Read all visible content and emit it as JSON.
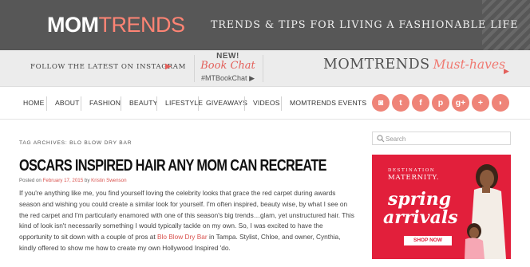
{
  "header": {
    "logo_part1": "MOM",
    "logo_part2": "TRENDS",
    "tagline": "TRENDS & TIPS FOR LIVING A FASHIONABLE LIFE"
  },
  "promo": {
    "instagram_label": "FOLLOW THE LATEST ON INSTAGRAM",
    "instagram_arrow": "▶",
    "book_new": "NEW!",
    "book_title": "Book Chat",
    "book_hashtag": "#MTBookChat",
    "book_arrow": "▶",
    "musthaves_main": "MOMTRENDS",
    "musthaves_sub": "Must-haves",
    "musthaves_arrow": "▶"
  },
  "nav": {
    "items": [
      "HOME",
      "ABOUT",
      "FASHION",
      "BEAUTY",
      "LIFESTYLE",
      "GIVEAWAYS",
      "VIDEOS",
      "MOMTRENDS EVENTS"
    ]
  },
  "social": [
    {
      "icon": "instagram-icon",
      "glyph": "◙"
    },
    {
      "icon": "twitter-icon",
      "glyph": "t"
    },
    {
      "icon": "facebook-icon",
      "glyph": "f"
    },
    {
      "icon": "pinterest-icon",
      "glyph": "p"
    },
    {
      "icon": "google-plus-icon",
      "glyph": "g+"
    },
    {
      "icon": "add-icon",
      "glyph": "+"
    },
    {
      "icon": "rss-icon",
      "glyph": "◗"
    }
  ],
  "colors": {
    "header_bg": "#575757",
    "accent": "#ef8478",
    "link": "#d9534f",
    "ad_bg": "#e21f3b"
  },
  "content": {
    "tag_archive": "TAG ARCHIVES: BLO BLOW DRY BAR",
    "title": "OSCARS INSPIRED HAIR ANY MOM CAN RECREATE",
    "meta_prefix": "Posted on ",
    "meta_date": "February 17, 2015",
    "meta_by": " by ",
    "meta_author": "Kristin Swenson",
    "body_part1": "If you're anything like me, you find yourself loving the celebrity looks that grace the red carpet during awards season and wishing you could create a similar look for yourself. I'm often inspired, beauty wise, by what I see on the red carpet and I'm particularly enamored with one of this season's big trends…glam, yet unstructured hair. This kind of look isn't necessarily something I would typically tackle on my own. So, I was excited to have the opportunity to sit down with a couple of pros at ",
    "body_link": "Blo Blow Dry Bar",
    "body_part2": " in Tampa. Stylist, Chloe, and owner, Cynthia, kindly offered to show me how to create my own Hollywood Inspired 'do."
  },
  "sidebar": {
    "search_placeholder": "Search",
    "ad_brand_line1": "DESTINATION",
    "ad_brand_line2": "MATERNITY.",
    "ad_headline1": "spring",
    "ad_headline2": "arrivals",
    "ad_cta": "SHOP NOW"
  }
}
